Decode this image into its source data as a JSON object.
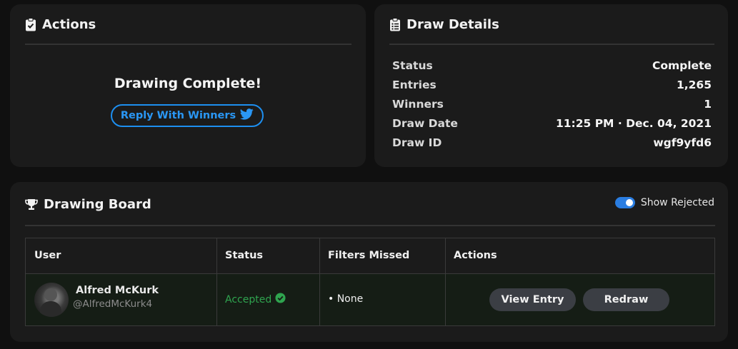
{
  "actions": {
    "title": "Actions",
    "icon": "clipboard-check-icon",
    "message": "Drawing Complete!",
    "reply_button_label": "Reply With Winners",
    "reply_icon": "twitter-icon",
    "accent_color": "#1d8ff0"
  },
  "draw_details": {
    "title": "Draw Details",
    "icon": "clipboard-list-icon",
    "rows": [
      {
        "label": "Status",
        "value": "Complete"
      },
      {
        "label": "Entries",
        "value": "1,265"
      },
      {
        "label": "Winners",
        "value": "1"
      },
      {
        "label": "Draw Date",
        "value": "11:25 PM · Dec. 04, 2021"
      },
      {
        "label": "Draw ID",
        "value": "wgf9yfd6"
      }
    ]
  },
  "board": {
    "title": "Drawing Board",
    "icon": "trophy-icon",
    "toggle_label": "Show Rejected",
    "toggle_on": true,
    "toggle_color": "#2a7de1",
    "columns": [
      "User",
      "Status",
      "Filters Missed",
      "Actions"
    ],
    "rows": [
      {
        "name": "Alfred McKurk",
        "handle": "@AlfredMcKurk4",
        "status": "Accepted",
        "status_color": "#2fa44f",
        "filters": "• None",
        "view_label": "View Entry",
        "redraw_label": "Redraw"
      }
    ]
  }
}
